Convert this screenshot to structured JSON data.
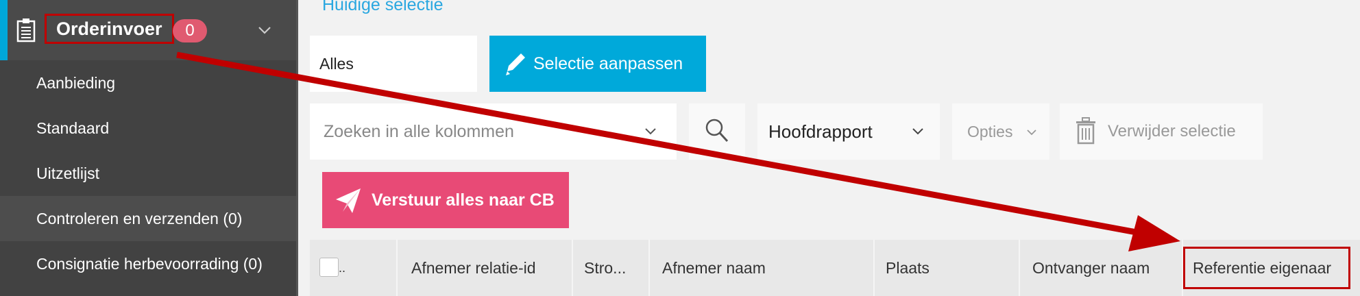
{
  "sidebar": {
    "header": {
      "title": "Orderinvoer",
      "badge": "0"
    },
    "items": [
      {
        "label": "Aanbieding"
      },
      {
        "label": "Standaard"
      },
      {
        "label": "Uitzetlijst"
      },
      {
        "label": "Controleren en verzenden (0)"
      },
      {
        "label": "Consignatie herbevoorrading (0)"
      }
    ]
  },
  "main": {
    "section_title": "Huidige selectie",
    "selection_value": "Alles",
    "edit_selection_label": "Selectie aanpassen",
    "search_placeholder": "Zoeken in alle kolommen",
    "report_select": "Hoofdrapport",
    "options_label": "Opties",
    "delete_selection_label": "Verwijder selectie",
    "send_all_label": "Verstuur alles naar CB"
  },
  "table": {
    "columns": [
      "Afnemer relatie-id",
      "Stro...",
      "Afnemer naam",
      "Plaats",
      "Ontvanger naam",
      "Referentie eigenaar"
    ],
    "checkbox_suffix": ".."
  },
  "colors": {
    "accent": "#00a7d8",
    "primary_button": "#00a9da",
    "send_button": "#e84a76",
    "badge": "#e05a70",
    "annotation": "#c00000"
  }
}
